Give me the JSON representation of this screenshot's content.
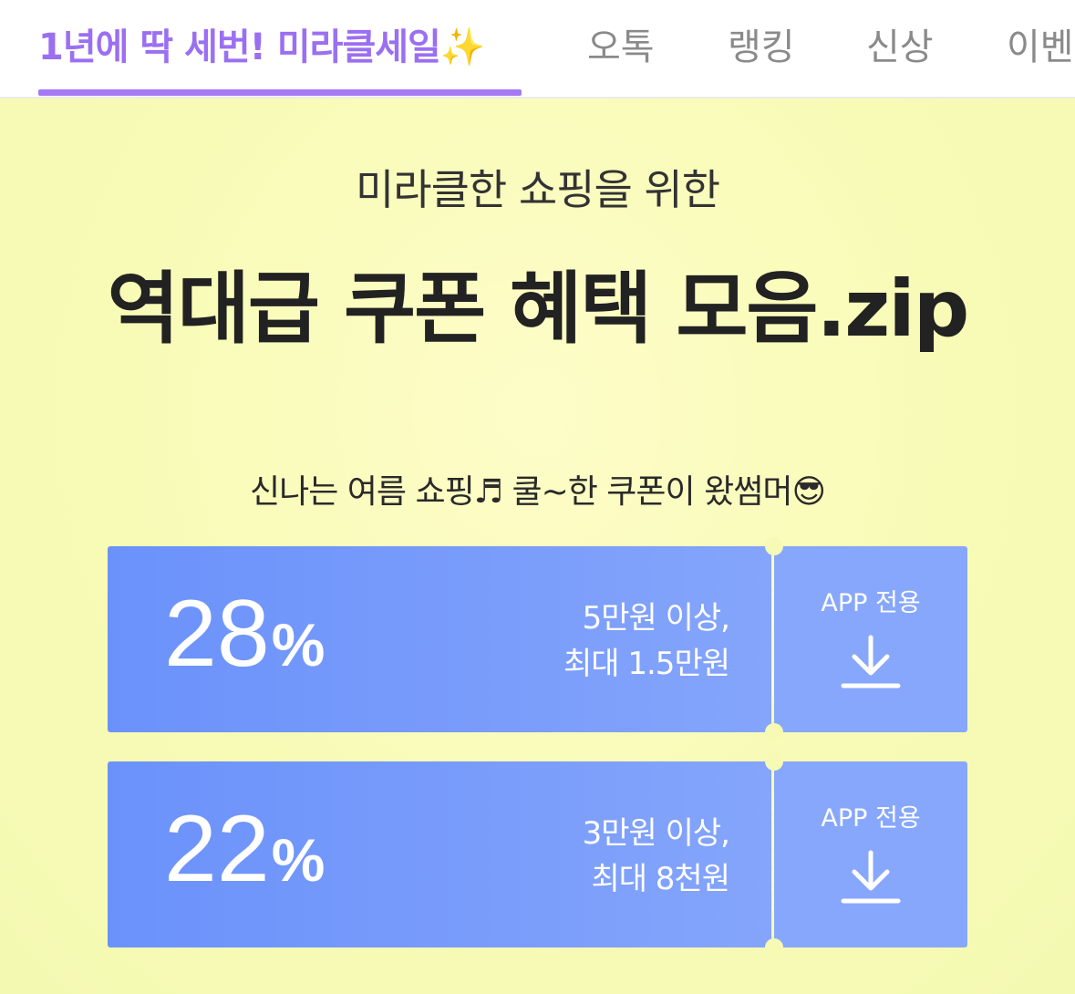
{
  "nav": {
    "tabs": [
      {
        "label": "1년에 딱 세번! 미라클세일✨",
        "active": true
      },
      {
        "label": "오톡",
        "active": false
      },
      {
        "label": "랭킹",
        "active": false
      },
      {
        "label": "신상",
        "active": false
      },
      {
        "label": "이벤",
        "active": false
      }
    ]
  },
  "hero": {
    "subtitle": "미라클한 쇼핑을 위한",
    "headline": "역대급 쿠폰 혜택 모음.zip",
    "notice": "신나는 여름 쇼핑♬ 쿨~한 쿠폰이 왔썸머😎"
  },
  "coupons": [
    {
      "percent": "28",
      "percent_sign": "%",
      "condition_line1": "5만원 이상,",
      "condition_line2": "최대 1.5만원",
      "app_label": "APP 전용",
      "icon": "download-icon"
    },
    {
      "percent": "22",
      "percent_sign": "%",
      "condition_line1": "3만원 이상,",
      "condition_line2": "최대 8천원",
      "app_label": "APP 전용",
      "icon": "download-icon"
    }
  ],
  "colors": {
    "accent": "#a67af5",
    "coupon_blue": "#7a9dfb",
    "background_yellow": "#f8fbb6"
  }
}
